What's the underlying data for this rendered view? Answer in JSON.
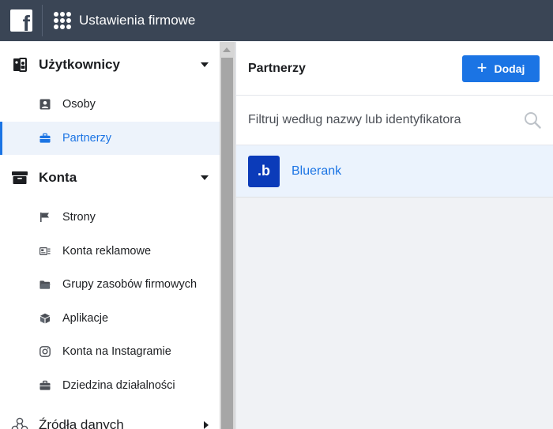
{
  "topbar": {
    "logo_icon": "facebook-logo-icon",
    "logo_glyph": "f",
    "apps_icon": "apps-grid-icon",
    "title": "Ustawienia firmowe"
  },
  "sidebar": {
    "sections": [
      {
        "label": "Użytkownicy",
        "icon": "users-icon",
        "expanded": true,
        "items": [
          {
            "label": "Osoby",
            "icon": "person-card-icon",
            "active": false
          },
          {
            "label": "Partnerzy",
            "icon": "briefcase-icon",
            "active": true
          }
        ]
      },
      {
        "label": "Konta",
        "icon": "accounts-box-icon",
        "expanded": true,
        "items": [
          {
            "label": "Strony",
            "icon": "flag-icon",
            "active": false
          },
          {
            "label": "Konta reklamowe",
            "icon": "ad-account-icon",
            "active": false
          },
          {
            "label": "Grupy zasobów firmowych",
            "icon": "folder-icon",
            "active": false
          },
          {
            "label": "Aplikacje",
            "icon": "cube-icon",
            "active": false
          },
          {
            "label": "Konta na Instagramie",
            "icon": "instagram-icon",
            "active": false
          },
          {
            "label": "Dziedzina działalności",
            "icon": "briefcase-icon",
            "active": false
          }
        ]
      },
      {
        "label": "Źródła danych",
        "icon": "data-sources-icon",
        "expanded": false,
        "items": []
      }
    ]
  },
  "main": {
    "title": "Partnerzy",
    "add_button": {
      "label": "Dodaj",
      "icon": "plus-icon",
      "glyph": "+"
    },
    "filter": {
      "placeholder": "Filtruj według nazwy lub identyfikatora",
      "value": "",
      "icon": "search-icon"
    },
    "partners": [
      {
        "name": "Bluerank",
        "avatar_text": ".b",
        "avatar_color": "#0b3bb9"
      }
    ]
  },
  "colors": {
    "topbar": "#3a4555",
    "accent": "#1b74e4",
    "active_bg": "#edf3fb"
  }
}
